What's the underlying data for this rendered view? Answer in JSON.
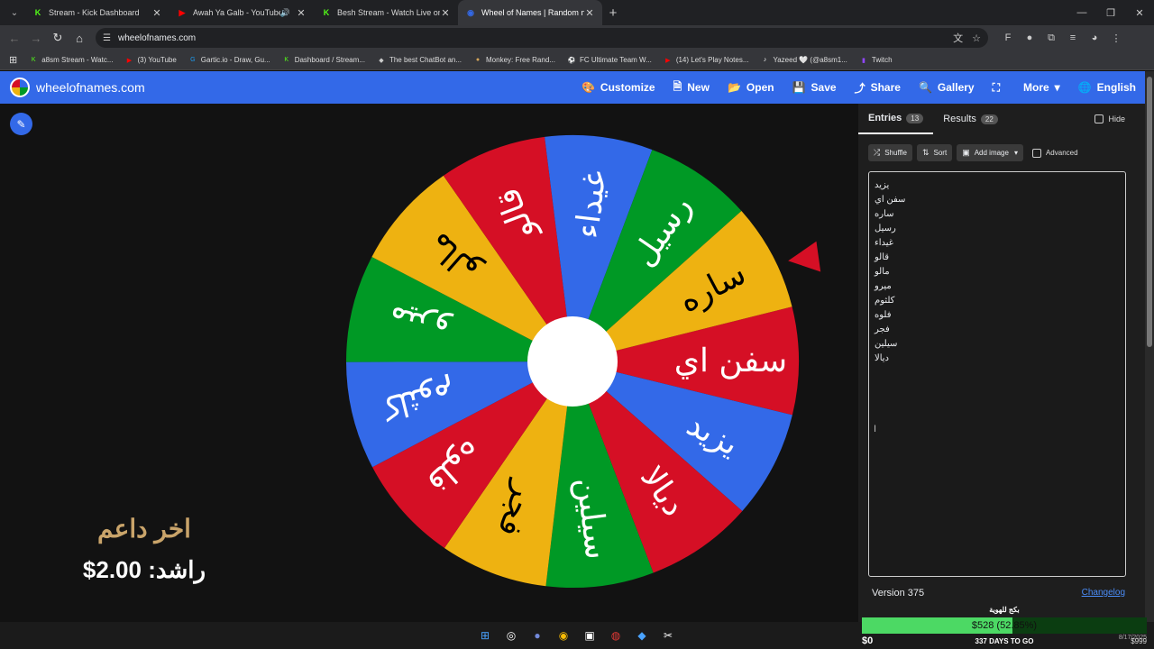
{
  "browser": {
    "tabs": [
      {
        "title": "Stream - Kick Dashboard",
        "icon": "kick-icon",
        "color": "#53fc18",
        "glyph": "K",
        "active": false
      },
      {
        "title": "Awah Ya Galb - YouTube",
        "icon": "youtube-icon",
        "color": "#ff0000",
        "glyph": "▶",
        "active": false
      },
      {
        "title": "Besh Stream - Watch Live on K",
        "icon": "kick-icon",
        "color": "#53fc18",
        "glyph": "K",
        "active": false
      },
      {
        "title": "Wheel of Names | Random nam",
        "icon": "wheel-icon",
        "color": "#3369e8",
        "glyph": "◉",
        "active": true
      }
    ],
    "url": "wheelofnames.com",
    "bookmarks": [
      {
        "label": "a8sm Stream - Watc...",
        "color": "#53fc18",
        "glyph": "K"
      },
      {
        "label": "(3) YouTube",
        "color": "#ff0000",
        "glyph": "▶"
      },
      {
        "label": "Gartic.io - Draw, Gu...",
        "color": "#1d9bf0",
        "glyph": "G"
      },
      {
        "label": "Dashboard / Stream...",
        "color": "#53fc18",
        "glyph": "K"
      },
      {
        "label": "The best ChatBot an...",
        "color": "#cccccc",
        "glyph": "◆"
      },
      {
        "label": "Monkey: Free Rand...",
        "color": "#d4a55a",
        "glyph": "●"
      },
      {
        "label": "FC Ultimate Team W...",
        "color": "#cccccc",
        "glyph": "⚽"
      },
      {
        "label": "(14) Let's Play Notes...",
        "color": "#ff0000",
        "glyph": "▶"
      },
      {
        "label": "Yazeed 🤍 (@a8sm1...",
        "color": "#ffffff",
        "glyph": "♪"
      },
      {
        "label": "Twitch",
        "color": "#9146ff",
        "glyph": "▮"
      }
    ]
  },
  "site": {
    "name": "wheelofnames.com",
    "menu": [
      {
        "label": "Customize",
        "icon": "palette-icon",
        "glyph": "🎨"
      },
      {
        "label": "New",
        "icon": "file-icon",
        "glyph": "🗎"
      },
      {
        "label": "Open",
        "icon": "folder-icon",
        "glyph": "📂"
      },
      {
        "label": "Save",
        "icon": "save-icon",
        "glyph": "💾"
      },
      {
        "label": "Share",
        "icon": "share-icon",
        "glyph": "⤴"
      },
      {
        "label": "Gallery",
        "icon": "search-icon",
        "glyph": "🔍"
      },
      {
        "label": "",
        "icon": "fullscreen-icon",
        "glyph": "⛶"
      },
      {
        "label": "More",
        "icon": "chevron-down-icon",
        "glyph": "▾"
      },
      {
        "label": "English",
        "icon": "globe-icon",
        "glyph": "🌐"
      }
    ]
  },
  "wheel": {
    "segments": [
      {
        "label": "سفن اي",
        "color": "#d50f25"
      },
      {
        "label": "يزيد",
        "color": "#3369e8"
      },
      {
        "label": "ديالا",
        "color": "#d50f25"
      },
      {
        "label": "سيلين",
        "color": "#009925"
      },
      {
        "label": "فجر",
        "color": "#eeb211"
      },
      {
        "label": "فلوه",
        "color": "#d50f25"
      },
      {
        "label": "كلثوم",
        "color": "#3369e8"
      },
      {
        "label": "ميرو",
        "color": "#009925"
      },
      {
        "label": "مالو",
        "color": "#eeb211"
      },
      {
        "label": "قالو",
        "color": "#d50f25"
      },
      {
        "label": "غيداء",
        "color": "#3369e8"
      },
      {
        "label": "رسيل",
        "color": "#009925"
      },
      {
        "label": "ساره",
        "color": "#eeb211"
      }
    ]
  },
  "overlay": {
    "supporter_title": "اخر داعم",
    "supporter_line": "راشد: 2.00$"
  },
  "sidebar": {
    "tabs": [
      {
        "label": "Entries",
        "count": "13"
      },
      {
        "label": "Results",
        "count": "22"
      }
    ],
    "hide_label": "Hide",
    "tools": [
      {
        "label": "Shuffle",
        "icon": "shuffle-icon",
        "glyph": "⤮"
      },
      {
        "label": "Sort",
        "icon": "sort-icon",
        "glyph": "⇅"
      },
      {
        "label": "Add image",
        "icon": "image-icon",
        "glyph": "🖼"
      }
    ],
    "advanced_label": "Advanced",
    "entries": [
      "يزيد",
      "سفن اي",
      "ساره",
      "رسيل",
      "غيداء",
      "قالو",
      "مالو",
      "ميرو",
      "كلثوم",
      "فلوه",
      "فجر",
      "سيلين",
      "ديالا"
    ],
    "version": "Version 375",
    "changelog": "Changelog"
  },
  "goal": {
    "title": "بكج للهوية",
    "text": "$528 (52.85%)",
    "progress": 0.5285,
    "min": "$0",
    "days": "337 DAYS TO GO",
    "max": "$999",
    "date": "8/17/2025"
  }
}
